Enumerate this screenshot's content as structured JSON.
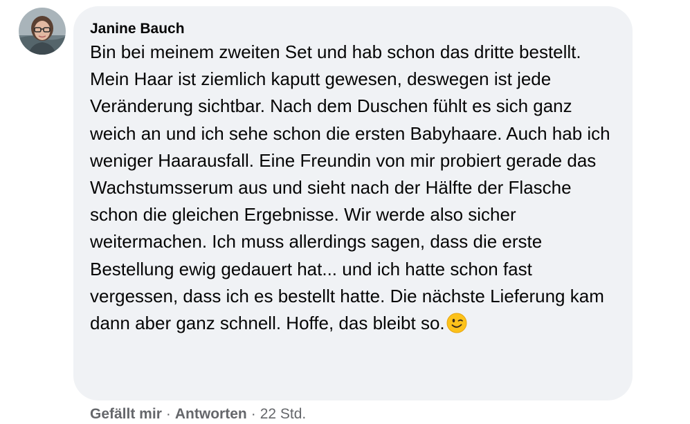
{
  "comment": {
    "author": "Janine Bauch",
    "text": "Bin bei meinem zweiten Set und hab schon das dritte bestellt. Mein Haar ist ziemlich kaputt gewesen, deswegen ist jede Veränderung sichtbar. Nach dem Duschen fühlt es sich ganz weich an und ich sehe schon die ersten Babyhaare. Auch hab ich weniger Haarausfall. Eine Freundin von mir probiert gerade das Wachstumsserum aus und sieht nach der Hälfte der Flasche schon die gleichen Ergebnisse. Wir werde also sicher weitermachen. Ich muss allerdings sagen, dass die erste Bestellung ewig gedauert hat... und ich hatte schon fast vergessen, dass ich es bestellt hatte. Die nächste Lieferung kam dann aber ganz schnell. Hoffe, das bleibt so.",
    "emoji": "winking-face-emoji",
    "avatar_icon": "user-avatar-photo"
  },
  "actions": {
    "like_label": "Gefällt mir",
    "separator": "·",
    "reply_label": "Antworten",
    "timestamp": "22 Std."
  },
  "colors": {
    "bubble_bg": "#f0f2f5",
    "text": "#050505",
    "secondary_text": "#65676b"
  }
}
